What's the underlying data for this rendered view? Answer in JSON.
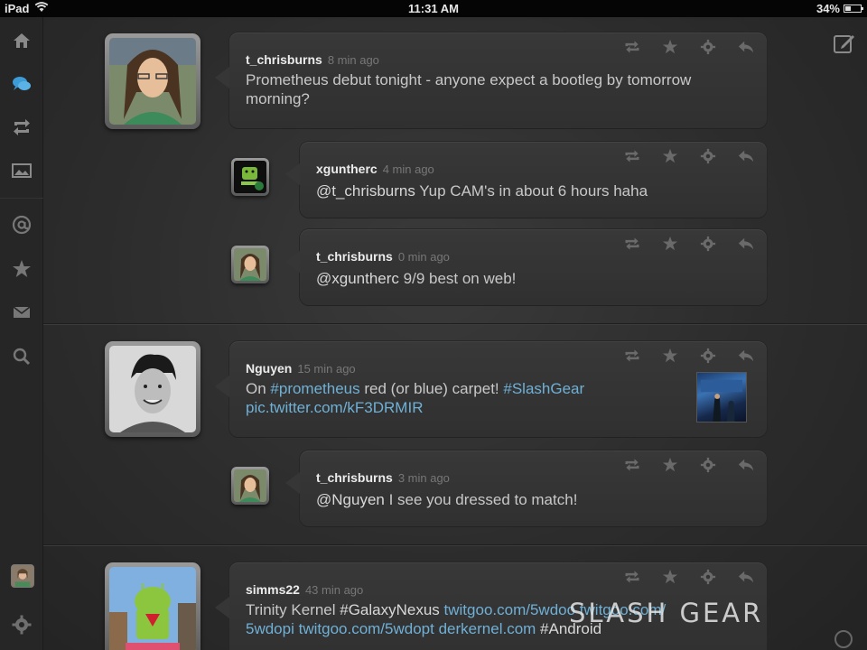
{
  "status_bar": {
    "device": "iPad",
    "time": "11:31 AM",
    "battery": "34%",
    "battery_level": 0.34
  },
  "sidebar": {
    "items": [
      {
        "name": "home-icon",
        "active": false
      },
      {
        "name": "conversations-icon",
        "active": true
      },
      {
        "name": "retweets-icon",
        "active": false
      },
      {
        "name": "media-icon",
        "active": false
      },
      {
        "name": "mentions-icon",
        "active": false
      },
      {
        "name": "favorites-icon",
        "active": false
      },
      {
        "name": "messages-icon",
        "active": false
      },
      {
        "name": "search-icon",
        "active": false
      }
    ],
    "bottom": [
      "profile-avatar",
      "settings-gear-icon"
    ]
  },
  "colors": {
    "accent": "#3d9bd6",
    "link": "#6fb0d6",
    "background": "#2b2b2b"
  },
  "tweets": [
    {
      "user": "t_chrisburns",
      "time": "8 min ago",
      "text": "Prometheus debut tonight - anyone expect a bootleg by tomorrow morning?"
    },
    {
      "user": "xguntherc",
      "time": "4 min ago",
      "mention": "@t_chrisburns",
      "text": " Yup CAM's in about 6 hours haha"
    },
    {
      "user": "t_chrisburns",
      "time": "0 min ago",
      "mention": "@xguntherc",
      "text": " 9/9 best on web!"
    },
    {
      "user": "Nguyen",
      "time": "15 min ago",
      "t1": "On ",
      "h1": "#prometheus",
      "t2": " red (or blue) carpet! ",
      "h2": "#SlashGear",
      "link": "pic.twitter.com/kF3DRMIR"
    },
    {
      "user": "t_chrisburns",
      "time": "3 min ago",
      "mention": "@Nguyen",
      "text": " I see you dressed to match!"
    },
    {
      "user": "simms22",
      "time": "43 min ago",
      "t1": "Trinity Kernel ",
      "h1": "#GalaxyNexus",
      "l1": "twitgoo.com/5wdoo",
      "l2": "twitgoo.com/",
      "l3": "5wdopi",
      "l4": "twitgoo.com/5wdopt",
      "l5": "derkernel.com",
      "h2": "#Android"
    }
  ],
  "watermark": "SLASH GEAR"
}
